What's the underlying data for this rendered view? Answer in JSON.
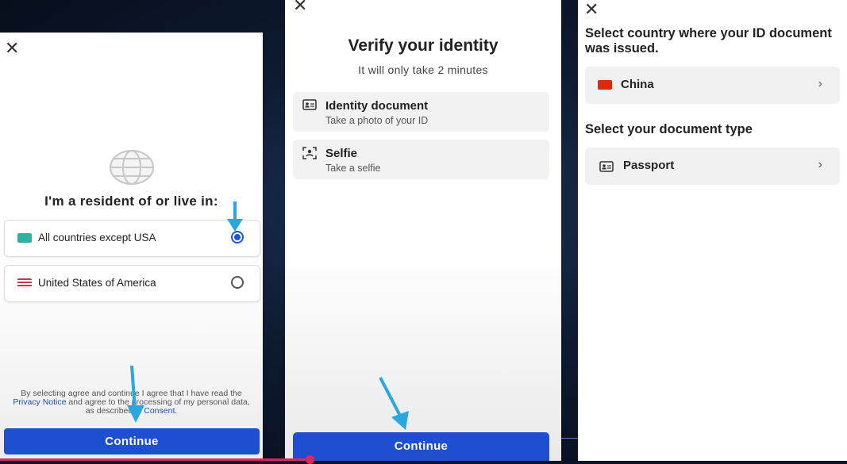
{
  "panel1": {
    "heading": "I'm a resident of or live in:",
    "options": [
      {
        "label": "All countries except USA",
        "selected": true,
        "flag_color": "#2bb3a0"
      },
      {
        "label": "United States of America",
        "selected": false,
        "flag_color": "#c23a4a"
      }
    ],
    "consent": {
      "part1": "By selecting agree and continue I agree that I have read the ",
      "privacy_link": "Privacy Notice",
      "part2": " and agree to the processing of my personal data, as described in ",
      "consent_link": "Consent",
      "part3": "."
    },
    "continue_label": "Continue"
  },
  "panel2": {
    "title": "Verify your identity",
    "subtitle": "It will only take 2 minutes",
    "steps": [
      {
        "title": "Identity document",
        "subtitle": "Take a photo of your ID",
        "icon": "id-card-icon"
      },
      {
        "title": "Selfie",
        "subtitle": "Take a selfie",
        "icon": "face-scan-icon"
      }
    ],
    "continue_label": "Continue"
  },
  "panel3": {
    "country_heading": "Select country where your ID document was issued.",
    "country": {
      "label": "China",
      "flag_color": "#de2910"
    },
    "doctype_heading": "Select your document type",
    "doctype": {
      "label": "Passport",
      "icon": "id-card-icon"
    }
  },
  "colors": {
    "primary": "#1f4fd1",
    "arrow": "#29a8e0",
    "link": "#1c4fb5"
  }
}
